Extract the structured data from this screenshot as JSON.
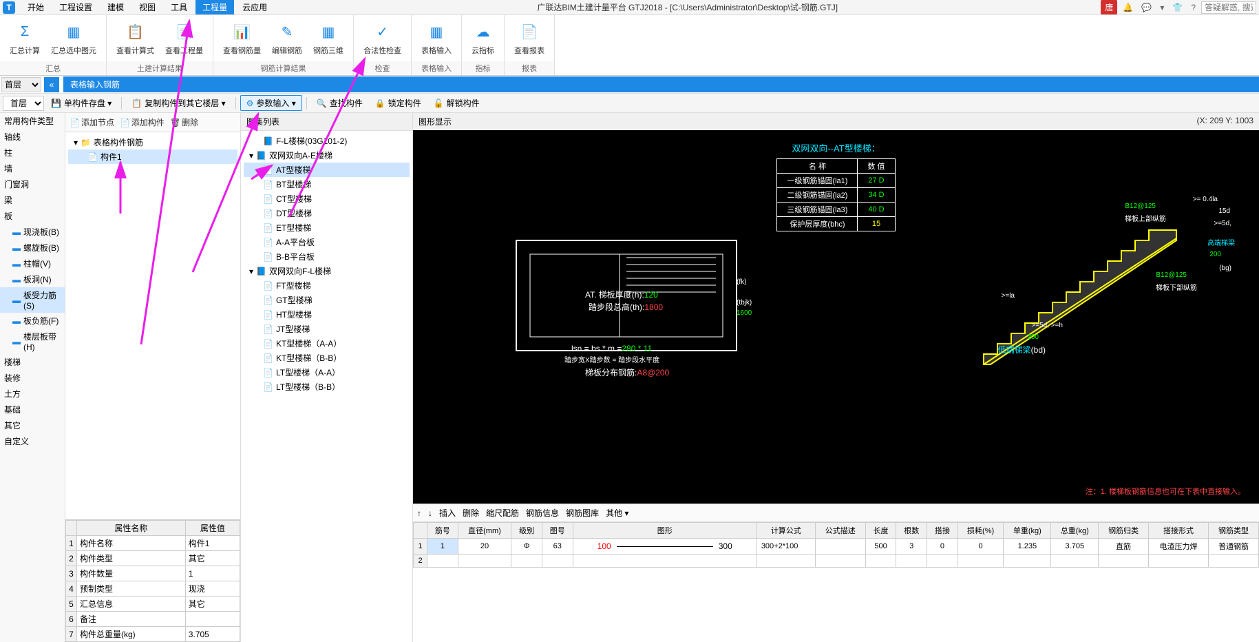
{
  "app": {
    "title": "广联达BIM土建计量平台 GTJ2018 - [C:\\Users\\Administrator\\Desktop\\试-钢筋.GTJ]",
    "logo": "T",
    "menu": [
      "开始",
      "工程设置",
      "建模",
      "视图",
      "工具",
      "工程量",
      "云应用"
    ],
    "menu_active": 5,
    "user": "唐",
    "search_placeholder": "答疑解惑, 搜这"
  },
  "ribbon": {
    "groups": [
      {
        "label": "汇总",
        "items": [
          {
            "label": "汇总计算",
            "icon": "Σ"
          },
          {
            "label": "汇总选中图元",
            "icon": "▦"
          }
        ]
      },
      {
        "label": "土建计算结果",
        "items": [
          {
            "label": "查看计算式",
            "icon": "📋"
          },
          {
            "label": "查看工程量",
            "icon": "📄"
          }
        ]
      },
      {
        "label": "钢筋计算结果",
        "items": [
          {
            "label": "查看钢筋量",
            "icon": "📊"
          },
          {
            "label": "编辑钢筋",
            "icon": "✎"
          },
          {
            "label": "钢筋三维",
            "icon": "▦"
          }
        ]
      },
      {
        "label": "检查",
        "items": [
          {
            "label": "合法性检查",
            "icon": "✓"
          }
        ]
      },
      {
        "label": "表格输入",
        "items": [
          {
            "label": "表格输入",
            "icon": "▦"
          }
        ]
      },
      {
        "label": "指标",
        "items": [
          {
            "label": "云指标",
            "icon": "☁"
          }
        ]
      },
      {
        "label": "报表",
        "items": [
          {
            "label": "查看报表",
            "icon": "📄"
          }
        ]
      }
    ]
  },
  "floor": {
    "select": "首层",
    "blue_label": "表格输入钢筋"
  },
  "toolbar": {
    "floor": "首层",
    "btns": [
      "单构件存盘",
      "复制构件到其它楼层",
      "参数输入",
      "查找构件",
      "锁定构件",
      "解锁构件"
    ],
    "highlighted": 2
  },
  "categories": [
    {
      "label": "常用构件类型"
    },
    {
      "label": "轴线"
    },
    {
      "label": "柱"
    },
    {
      "label": "墙"
    },
    {
      "label": "门窗洞"
    },
    {
      "label": "梁"
    },
    {
      "label": "板"
    },
    {
      "label": "现浇板(B)",
      "sub": true
    },
    {
      "label": "螺旋板(B)",
      "sub": true
    },
    {
      "label": "柱帽(V)",
      "sub": true
    },
    {
      "label": "板洞(N)",
      "sub": true
    },
    {
      "label": "板受力筋(S)",
      "sub": true,
      "selected": true
    },
    {
      "label": "板负筋(F)",
      "sub": true
    },
    {
      "label": "楼层板带(H)",
      "sub": true
    },
    {
      "label": "楼梯"
    },
    {
      "label": "装修"
    },
    {
      "label": "土方"
    },
    {
      "label": "基础"
    },
    {
      "label": "其它"
    },
    {
      "label": "自定义"
    }
  ],
  "comp_toolbar": {
    "add_node": "添加节点",
    "add_comp": "添加构件",
    "delete": "删除"
  },
  "comp_tree": {
    "root": "表格构件钢筋",
    "child": "构件1"
  },
  "properties": {
    "headers": [
      "属性名称",
      "属性值"
    ],
    "rows": [
      {
        "n": "1",
        "name": "构件名称",
        "val": "构件1"
      },
      {
        "n": "2",
        "name": "构件类型",
        "val": "其它"
      },
      {
        "n": "3",
        "name": "构件数量",
        "val": "1"
      },
      {
        "n": "4",
        "name": "预制类型",
        "val": "现浇"
      },
      {
        "n": "5",
        "name": "汇总信息",
        "val": "其它"
      },
      {
        "n": "6",
        "name": "备注",
        "val": ""
      },
      {
        "n": "7",
        "name": "构件总重量(kg)",
        "val": "3.705"
      }
    ]
  },
  "template": {
    "header": "图集列表",
    "tree": [
      {
        "lvl": 2,
        "icon": "book",
        "label": "F-L楼梯(03G101-2)"
      },
      {
        "lvl": 1,
        "icon": "book",
        "label": "双网双向A-E楼梯",
        "expand": "▾"
      },
      {
        "lvl": 2,
        "icon": "page",
        "label": "AT型楼梯",
        "selected": true
      },
      {
        "lvl": 2,
        "icon": "page",
        "label": "BT型楼梯"
      },
      {
        "lvl": 2,
        "icon": "page",
        "label": "CT型楼梯"
      },
      {
        "lvl": 2,
        "icon": "page",
        "label": "DT型楼梯"
      },
      {
        "lvl": 2,
        "icon": "page",
        "label": "ET型楼梯"
      },
      {
        "lvl": 2,
        "icon": "page",
        "label": "A-A平台板"
      },
      {
        "lvl": 2,
        "icon": "page",
        "label": "B-B平台板"
      },
      {
        "lvl": 1,
        "icon": "book",
        "label": "双网双向F-L楼梯",
        "expand": "▾"
      },
      {
        "lvl": 2,
        "icon": "page",
        "label": "FT型楼梯"
      },
      {
        "lvl": 2,
        "icon": "page",
        "label": "GT型楼梯"
      },
      {
        "lvl": 2,
        "icon": "page",
        "label": "HT型楼梯"
      },
      {
        "lvl": 2,
        "icon": "page",
        "label": "JT型楼梯"
      },
      {
        "lvl": 2,
        "icon": "page",
        "label": "KT型楼梯（A-A）"
      },
      {
        "lvl": 2,
        "icon": "page",
        "label": "KT型楼梯（B-B）"
      },
      {
        "lvl": 2,
        "icon": "page",
        "label": "LT型楼梯（A-A）"
      },
      {
        "lvl": 2,
        "icon": "page",
        "label": "LT型楼梯（B-B）"
      }
    ]
  },
  "diagram": {
    "header": "图形显示",
    "coords": "(X: 209 Y: 1003",
    "title": "双网双向--AT型楼梯：",
    "table_header": [
      "名  称",
      "数  值"
    ],
    "table_rows": [
      {
        "name": "一级钢筋锚固(la1)",
        "val": "27 D"
      },
      {
        "name": "二级钢筋锚固(la2)",
        "val": "34 D"
      },
      {
        "name": "三级钢筋锚固(la3)",
        "val": "40 D"
      },
      {
        "name": "保护层厚度(bhc)",
        "val": "15"
      }
    ],
    "labels": {
      "fk": "(fk)",
      "tbjk": "(tbjk)",
      "tbjk_val": "1600",
      "h_label": "AT. 梯板厚度(h):",
      "h_val": "120",
      "th_label": "踏步段总高(th):",
      "th_val": "1800",
      "lsn": "lsn = bs * m =",
      "lsn_val": "280 * 11",
      "step_formula": "踏步宽X踏步数 = 踏步段水平度",
      "dist_rebar": "梯板分布钢筋:",
      "dist_rebar_val": "A8@200",
      "top_rebar": "B12@125",
      "top_rebar_label": "梯板上部纵筋",
      "bot_rebar": "B12@125",
      "bot_rebar_label": "梯板下部纵筋",
      "high_beam": "高端梯梁",
      "low_beam": "低端梯梁",
      "low_beam_val": "(bd)",
      "bg": "(bg)",
      "d5": ">=5d, >=h",
      "d5b": ">=5d,",
      "la": ">=la",
      "d04": ">= 0.4la",
      "d15": "15d",
      "v200a": "200",
      "v200b": "200"
    },
    "note": "注：1. 楼梯板钢筋信息也可在下表中直接输入。"
  },
  "rebar": {
    "toolbar": [
      "↑",
      "↓",
      "插入",
      "删除",
      "缩尺配筋",
      "钢筋信息",
      "钢筋图库",
      "其他 ▾"
    ],
    "headers": [
      "",
      "筋号",
      "直径(mm)",
      "级别",
      "图号",
      "图形",
      "计算公式",
      "公式描述",
      "长度",
      "根数",
      "搭接",
      "损耗(%)",
      "单重(kg)",
      "总重(kg)",
      "钢筋归类",
      "搭接形式",
      "钢筋类型"
    ],
    "rows": [
      {
        "n": "1",
        "num": "1",
        "dia": "20",
        "grade": "Φ",
        "fig": "63",
        "shape_a": "100",
        "shape_b": "300",
        "formula": "300+2*100",
        "desc": "",
        "len": "500",
        "qty": "3",
        "lap": "0",
        "loss": "0",
        "unit": "1.235",
        "total": "3.705",
        "cat": "直筋",
        "lap_type": "电渣压力焊",
        "type": "普通钢筋"
      },
      {
        "n": "2"
      }
    ]
  }
}
